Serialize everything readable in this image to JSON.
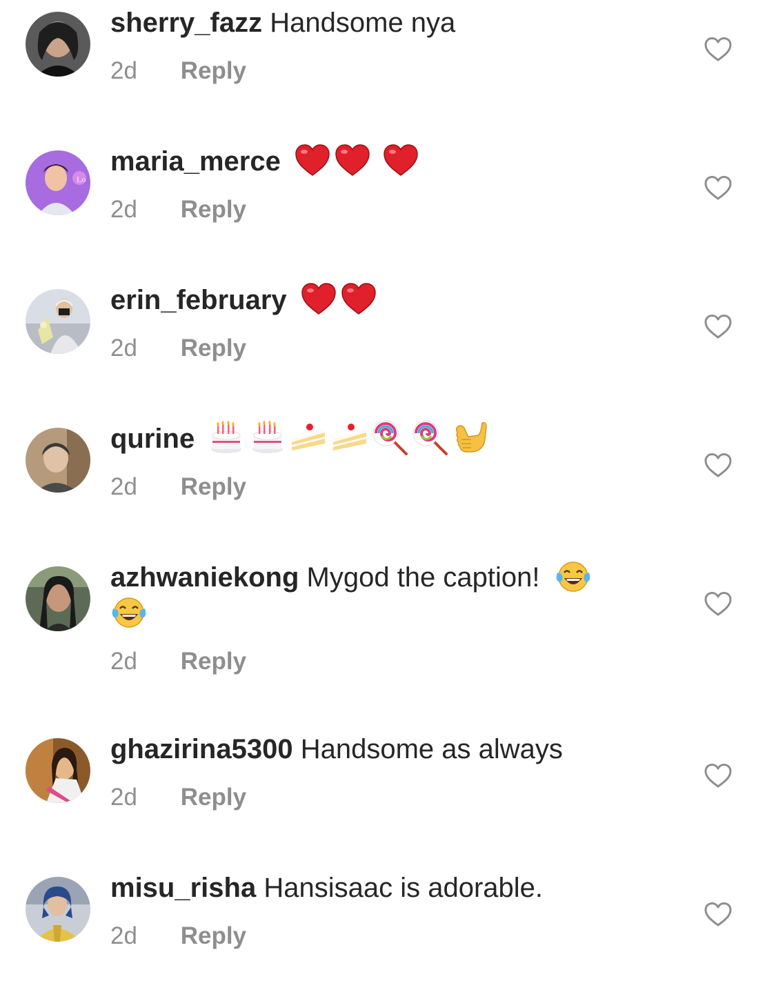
{
  "comments": [
    {
      "username": "sherry_fazz",
      "text": "Handsome nya",
      "emojis": [],
      "time": "2d",
      "reply_label": "Reply",
      "avatar_colors": [
        "#3a3a3a",
        "#c9a48a",
        "#1a1a1a"
      ]
    },
    {
      "username": "maria_merce",
      "text": "",
      "emojis": [
        "heart-emoji",
        "heart-emoji",
        "heart-emoji"
      ],
      "time": "2d",
      "reply_label": "Reply",
      "avatar_colors": [
        "#a86be0",
        "#f1c2a6",
        "#5a2a7a"
      ]
    },
    {
      "username": "erin_february",
      "text": "",
      "emojis": [
        "heart-emoji",
        "heart-emoji"
      ],
      "time": "2d",
      "reply_label": "Reply",
      "avatar_colors": [
        "#d8dde6",
        "#2b2b2b",
        "#e7e4a5"
      ]
    },
    {
      "username": "qurine",
      "text": "",
      "emojis": [
        "birthday-cake-emoji",
        "birthday-cake-emoji",
        "shortcake-emoji",
        "shortcake-emoji",
        "lollipop-emoji",
        "lollipop-emoji",
        "call-me-hand-emoji"
      ],
      "time": "2d",
      "reply_label": "Reply",
      "avatar_colors": [
        "#b59a7b",
        "#e0c2a8",
        "#4a4a4a"
      ]
    },
    {
      "username": "azhwaniekong",
      "text": "Mygod the caption!",
      "emojis": [
        "tears-of-joy-emoji",
        "tears-of-joy-emoji"
      ],
      "time": "2d",
      "reply_label": "Reply",
      "avatar_colors": [
        "#5d6b56",
        "#c7977b",
        "#1a1a1a"
      ]
    },
    {
      "username": "ghazirina5300",
      "text": "Handsome as always",
      "emojis": [],
      "time": "2d",
      "reply_label": "Reply",
      "avatar_colors": [
        "#8b5a2b",
        "#e5b88c",
        "#e04a8a"
      ]
    },
    {
      "username": "misu_risha",
      "text": "Hansisaac is adorable.",
      "emojis": [],
      "time": "2d",
      "reply_label": "Reply",
      "avatar_colors": [
        "#c9ced6",
        "#e4c24a",
        "#2a4a8a"
      ]
    }
  ],
  "colors": {
    "text": "#262626",
    "meta": "#8e8e8e",
    "heart_outline": "#8e8e8e",
    "emoji_heart": "#e0202a"
  }
}
